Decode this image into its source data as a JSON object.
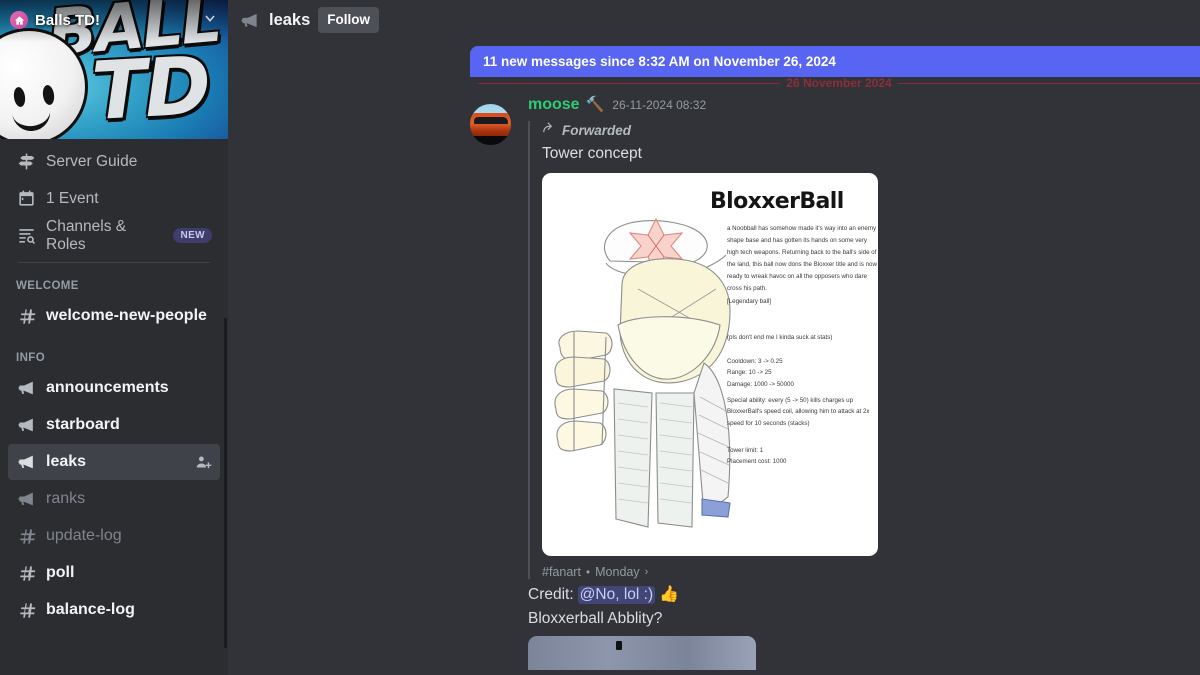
{
  "sidebar": {
    "server_name": "Balls TD!",
    "banner_text_1": "BALL",
    "banner_text_2": "TD",
    "nav": [
      {
        "label": "Server Guide",
        "icon": "signpost-icon",
        "badge": ""
      },
      {
        "label": "1 Event",
        "icon": "calendar-icon",
        "badge": ""
      },
      {
        "label": "Channels & Roles",
        "icon": "channels-roles-icon",
        "badge": "NEW"
      }
    ],
    "categories": [
      {
        "name": "WELCOME",
        "channels": [
          {
            "name": "welcome-new-people",
            "type": "text",
            "state": "unread"
          }
        ]
      },
      {
        "name": "INFO",
        "channels": [
          {
            "name": "announcements",
            "type": "announcement",
            "state": "unread"
          },
          {
            "name": "starboard",
            "type": "announcement",
            "state": "unread"
          },
          {
            "name": "leaks",
            "type": "announcement",
            "state": "active",
            "trailing_icon": "add-member-icon"
          },
          {
            "name": "ranks",
            "type": "announcement",
            "state": "read"
          },
          {
            "name": "update-log",
            "type": "text",
            "state": "read"
          },
          {
            "name": "poll",
            "type": "text",
            "state": "unread"
          },
          {
            "name": "balance-log",
            "type": "text",
            "state": "unread"
          }
        ]
      }
    ]
  },
  "header": {
    "channel_icon": "announcement-icon",
    "channel_name": "leaks",
    "follow_label": "Follow"
  },
  "new_messages_banner": {
    "text": "11 new messages since 8:32 AM on November 26, 2024",
    "color": "#5865f2"
  },
  "date_divider": {
    "text": "26 November 2024"
  },
  "message": {
    "avatar_icon": "car-avatar",
    "author": "moose",
    "author_color": "#2ecc71",
    "author_emoji": "🔨",
    "timestamp": "26-11-2024 08:32",
    "forwarded_label": "Forwarded",
    "forwarded_text": "Tower concept",
    "attachment": {
      "title": "BloxxerBall",
      "paragraph": "a Noobball has somehow made it's way into an enemy shape base and has gotten its hands on some very high tech weapons. Returning back to the ball's side of the land, this ball now dons the Bloxxer title and is now ready to wreak havoc on all the opposers who dare cross his path.\n[Legendary ball]",
      "note": "(pls don't end me I kinda suck at stats)",
      "stats": "Cooldown: 3 -> 0.25\nRange: 10 -> 25\nDamage: 1000 -> 50000",
      "ability": "Special ability: every (5 -> 50) kills charges up BloxxerBall's speed coil, allowing him to attack at 2x speed for 10 seconds (stacks)",
      "limits": "Tower limit: 1\nPlacement cost: 1000"
    },
    "attachment_footer": {
      "channel": "#fanart",
      "separator": "•",
      "day": "Monday",
      "chevron": "›"
    },
    "credit_prefix": "Credit:",
    "credit_mention": "@No, lol :)",
    "credit_emoji": "👍",
    "ability_question": "Bloxxerball Abblity?"
  }
}
